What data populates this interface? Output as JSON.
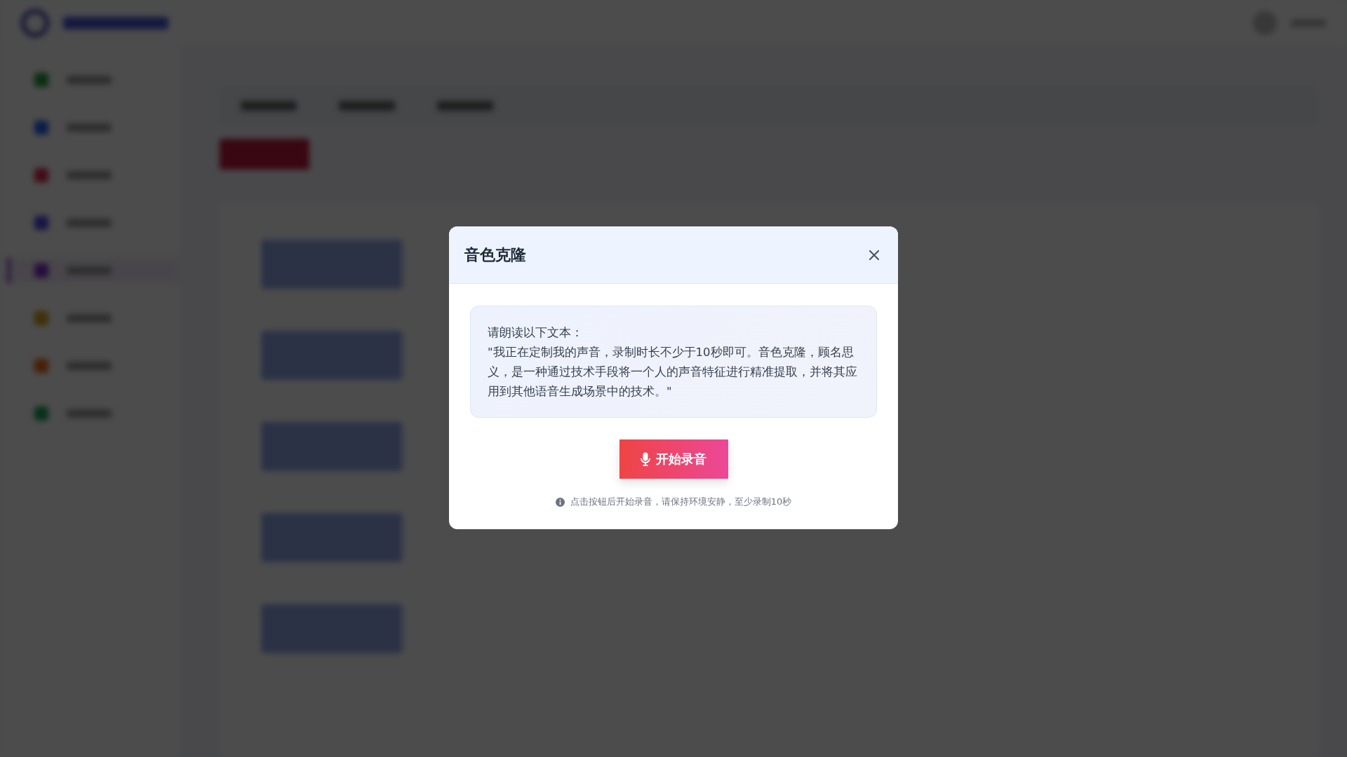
{
  "dialog": {
    "title": "音色克隆",
    "instruction": "请朗读以下文本：",
    "passage": "\"我正在定制我的声音，录制时长不少于10秒即可。音色克隆，顾名思义，是一种通过技术手段将一个人的声音特征进行精准提取，并将其应用到其他语音生成场景中的技术。\"",
    "record_button": "开始录音",
    "hint": "点击按钮后开始录音，请保持环境安静，至少录制10秒"
  }
}
